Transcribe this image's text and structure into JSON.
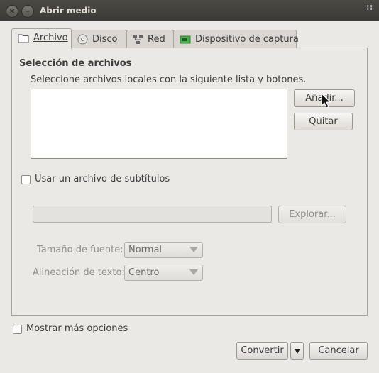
{
  "window": {
    "title": "Abrir medio"
  },
  "tabs": [
    {
      "label": "Archivo",
      "icon": "folder-icon",
      "active": true
    },
    {
      "label": "Disco",
      "icon": "disc-icon",
      "active": false
    },
    {
      "label": "Red",
      "icon": "network-icon",
      "active": false
    },
    {
      "label": "Dispositivo de captura",
      "icon": "capture-card-icon",
      "active": false
    }
  ],
  "file_selection": {
    "title": "Selección de archivos",
    "description": "Seleccione archivos locales con la siguiente lista y botones.",
    "add_button": "Añadir...",
    "remove_button": "Quitar"
  },
  "subtitles": {
    "checkbox_label": "Usar un archivo de subtítulos",
    "checked": false,
    "file_value": "",
    "browse_button": "Explorar...",
    "font_size_label": "Tamaño de fuente:",
    "font_size_value": "Normal",
    "alignment_label": "Alineación de texto:",
    "alignment_value": "Centro"
  },
  "footer": {
    "more_options_label": "Mostrar más opciones",
    "more_options_checked": false,
    "convert_button": "Convertir",
    "cancel_button": "Cancelar"
  }
}
